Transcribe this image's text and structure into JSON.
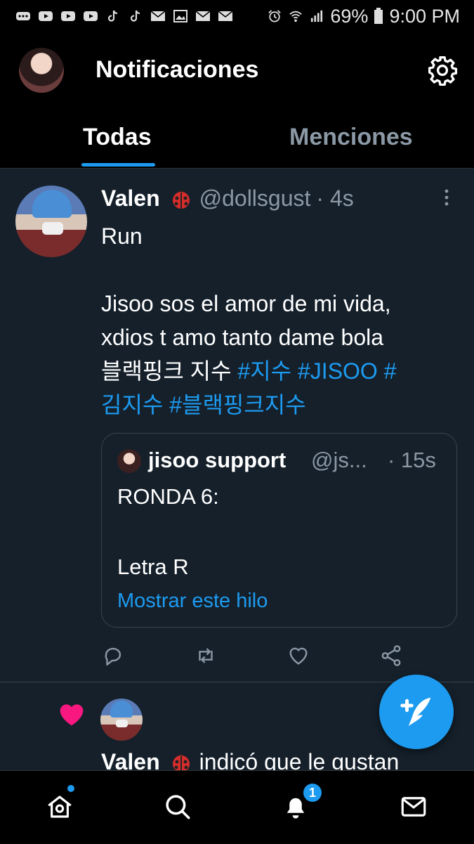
{
  "status_bar": {
    "battery": "69%",
    "time": "9:00 PM",
    "icons": [
      "more-icon",
      "youtube-icon",
      "youtube-icon",
      "youtube-icon",
      "tiktok-icon",
      "tiktok-icon",
      "mail-icon",
      "image-icon",
      "mail-icon",
      "mail-icon",
      "alarm-icon",
      "wifi-icon",
      "signal-icon",
      "battery-icon"
    ]
  },
  "header": {
    "title": "Notificaciones",
    "tabs": [
      {
        "label": "Todas",
        "active": true
      },
      {
        "label": "Menciones",
        "active": false
      }
    ]
  },
  "tweet": {
    "author_name": "Valen",
    "author_handle": "@dollsgust",
    "time": "· 4s",
    "text_lines": [
      "Run",
      "",
      "Jisoo sos el amor de mi vida,",
      "xdios t amo tanto dame bola"
    ],
    "korean_text": "블랙핑크 지수 ",
    "hashtags": [
      "#지수",
      "#JISOO",
      "#",
      "김지수",
      "#블랙핑크지수"
    ],
    "quote": {
      "author_name": "jisoo support",
      "author_handle": "@js...",
      "time": "· 15s",
      "line1": "RONDA 6:",
      "line2": "Letra R",
      "show_thread": "Mostrar este hilo"
    }
  },
  "notification": {
    "author_name": "Valen",
    "text": "indicó que le gustan"
  },
  "bottom_nav": {
    "notifications_badge": "1",
    "items": [
      "home-icon",
      "search-icon",
      "notifications-icon",
      "messages-icon"
    ]
  },
  "colors": {
    "background": "#15202b",
    "accent": "#1d9bf0",
    "secondary_text": "#8b98a5",
    "like": "#f91880"
  }
}
